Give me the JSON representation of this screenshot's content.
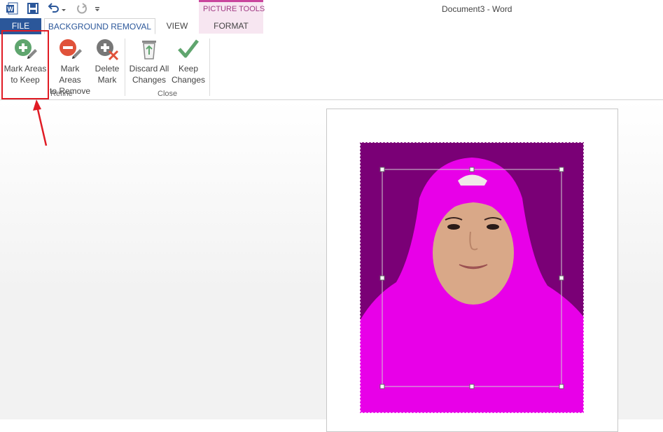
{
  "window": {
    "title": "Document3 - Word"
  },
  "quick_access": {
    "icons": [
      "word-logo-icon",
      "save-icon",
      "undo-icon",
      "undo-dropdown-icon",
      "redo-icon",
      "customize-qat-icon"
    ]
  },
  "contextual": {
    "label": "PICTURE TOOLS"
  },
  "tabs": {
    "file": "FILE",
    "background_removal": "BACKGROUND REMOVAL",
    "view": "VIEW",
    "format": "FORMAT"
  },
  "ribbon": {
    "refine": {
      "label": "Refine",
      "mark_keep": {
        "line1": "Mark Areas",
        "line2": "to Keep"
      },
      "mark_remove": {
        "line1": "Mark Areas",
        "line2": "to Remove"
      },
      "delete_mark": {
        "line1": "Delete",
        "line2": "Mark"
      }
    },
    "close": {
      "label": "Close",
      "discard": {
        "line1": "Discard All",
        "line2": "Changes"
      },
      "keep": {
        "line1": "Keep",
        "line2": "Changes"
      }
    }
  },
  "colors": {
    "file_tab": "#2b579a",
    "context_accent": "#c9459d",
    "removed_background": "#7a0076",
    "hijab": "#e800e8",
    "annotation": "#e01b24"
  }
}
